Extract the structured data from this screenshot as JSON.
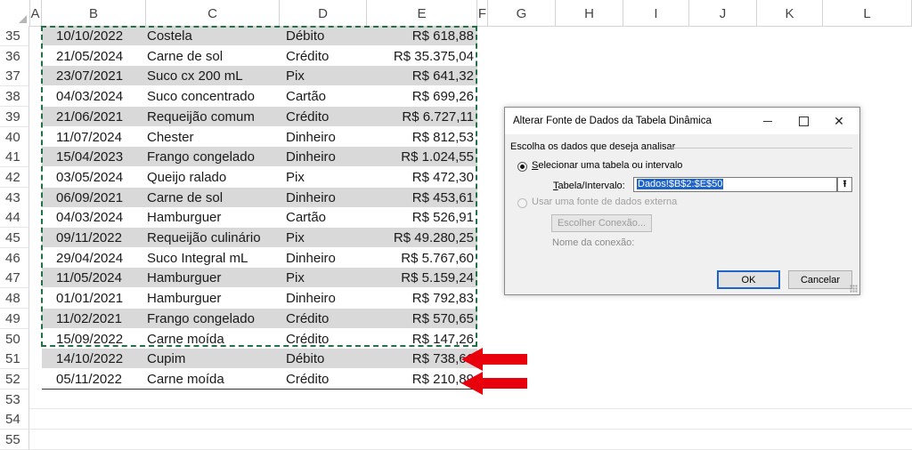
{
  "sheet": {
    "columns": [
      "A",
      "B",
      "C",
      "D",
      "E",
      "F",
      "G",
      "H",
      "I",
      "J",
      "K",
      "L"
    ],
    "rows": [
      {
        "num": "35",
        "date": "10/10/2022",
        "product": "Costela",
        "payment": "Débito",
        "value": "R$ 618,88"
      },
      {
        "num": "36",
        "date": "21/05/2024",
        "product": "Carne de sol",
        "payment": "Crédito",
        "value": "R$ 35.375,04"
      },
      {
        "num": "37",
        "date": "23/07/2021",
        "product": "Suco cx 200 mL",
        "payment": "Pix",
        "value": "R$ 641,32"
      },
      {
        "num": "38",
        "date": "04/03/2024",
        "product": "Suco concentrado",
        "payment": "Cartão",
        "value": "R$ 699,26"
      },
      {
        "num": "39",
        "date": "21/06/2021",
        "product": "Requeijão comum",
        "payment": "Crédito",
        "value": "R$ 6.727,11"
      },
      {
        "num": "40",
        "date": "11/07/2024",
        "product": "Chester",
        "payment": "Dinheiro",
        "value": "R$ 812,53"
      },
      {
        "num": "41",
        "date": "15/04/2023",
        "product": "Frango congelado",
        "payment": "Dinheiro",
        "value": "R$ 1.024,55"
      },
      {
        "num": "42",
        "date": "03/05/2024",
        "product": "Queijo ralado",
        "payment": "Pix",
        "value": "R$ 472,30"
      },
      {
        "num": "43",
        "date": "06/09/2021",
        "product": "Carne de sol",
        "payment": "Dinheiro",
        "value": "R$ 453,61"
      },
      {
        "num": "44",
        "date": "04/03/2024",
        "product": "Hamburguer",
        "payment": "Cartão",
        "value": "R$ 526,91"
      },
      {
        "num": "45",
        "date": "09/11/2022",
        "product": "Requeijão culinário",
        "payment": "Pix",
        "value": "R$ 49.280,25"
      },
      {
        "num": "46",
        "date": "29/04/2024",
        "product": "Suco Integral mL",
        "payment": "Dinheiro",
        "value": "R$ 5.767,60"
      },
      {
        "num": "47",
        "date": "11/05/2024",
        "product": "Hamburguer",
        "payment": "Pix",
        "value": "R$ 5.159,24"
      },
      {
        "num": "48",
        "date": "01/01/2021",
        "product": "Hamburguer",
        "payment": "Dinheiro",
        "value": "R$ 792,83"
      },
      {
        "num": "49",
        "date": "11/02/2021",
        "product": "Frango congelado",
        "payment": "Crédito",
        "value": "R$ 570,65"
      },
      {
        "num": "50",
        "date": "15/09/2022",
        "product": "Carne moída",
        "payment": "Crédito",
        "value": "R$ 147,26"
      },
      {
        "num": "51",
        "date": "14/10/2022",
        "product": "Cupim",
        "payment": "Débito",
        "value": "R$ 738,61"
      },
      {
        "num": "52",
        "date": "05/11/2022",
        "product": "Carne moída",
        "payment": "Crédito",
        "value": "R$ 210,89"
      }
    ],
    "empty_rows": [
      "53",
      "54",
      "55"
    ]
  },
  "dialog": {
    "title": "Alterar Fonte de Dados da Tabela Dinâmica",
    "group_label": "Escolha os dados que deseja analisar",
    "option_table": {
      "pre": "",
      "u": "S",
      "post": "elecionar uma tabela ou intervalo"
    },
    "range_label": {
      "u": "T",
      "post": "abela/Intervalo:"
    },
    "range_value": "Dados!$B$2:$E$50",
    "option_external": "Usar uma fonte de dados externa",
    "choose_connection": "Escolher Conexão...",
    "connection_name_label": "Nome da conexão:",
    "ok": "OK",
    "cancel": "Cancelar",
    "close_glyph": "✕",
    "collapse_glyph": "⭱"
  },
  "colors": {
    "marquee": "#217346",
    "arrow": "#e8000d",
    "shaded_row": "#d9d9d9",
    "focus": "#1e64c8"
  },
  "icons": [
    "select-all-icon",
    "minimize-icon",
    "maximize-icon",
    "close-icon",
    "collapse-dialog-icon",
    "red-arrow-icon"
  ]
}
